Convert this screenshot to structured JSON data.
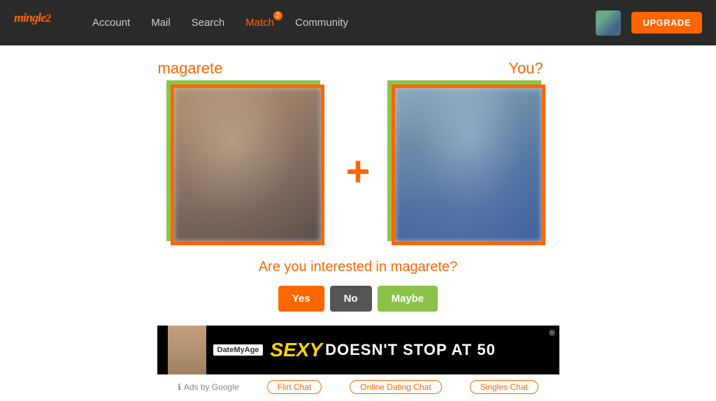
{
  "header": {
    "logo": "mingle",
    "logo_suffix": "2",
    "nav": [
      {
        "label": "Account",
        "id": "account",
        "active": false
      },
      {
        "label": "Mail",
        "id": "mail",
        "active": false
      },
      {
        "label": "Search",
        "id": "search",
        "active": false
      },
      {
        "label": "Match",
        "id": "match",
        "active": true,
        "badge": "2"
      },
      {
        "label": "Community",
        "id": "community",
        "active": false
      }
    ],
    "upgrade_label": "UPGRADE"
  },
  "main": {
    "profile1_name": "magarete",
    "profile2_name": "You?",
    "question": "Are you interested in magarete?",
    "btn_yes": "Yes",
    "btn_no": "No",
    "btn_maybe": "Maybe"
  },
  "ad": {
    "brand": "DateMyAge",
    "sexy": "SEXY",
    "rest": "DOESN'T STOP AT 50",
    "close": "⊗"
  },
  "footer": {
    "ads_label": "Ads by Google",
    "links": [
      {
        "label": "Flirt Chat"
      },
      {
        "label": "Online Dating Chat"
      },
      {
        "label": "Singles Chat"
      }
    ]
  }
}
